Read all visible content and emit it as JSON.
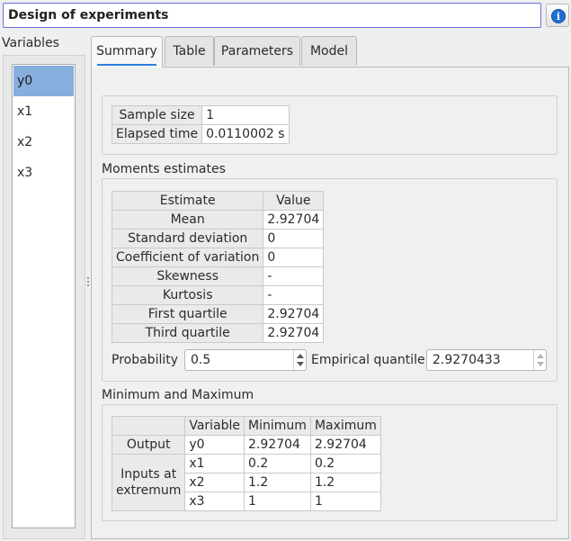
{
  "header": {
    "title": "Design of experiments",
    "info_icon": "info-icon",
    "info_glyph": "i"
  },
  "variables": {
    "label": "Variables",
    "items": [
      "y0",
      "x1",
      "x2",
      "x3"
    ],
    "selected": "y0"
  },
  "tabs": [
    "Summary",
    "Table",
    "Parameters",
    "Model"
  ],
  "active_tab": "Summary",
  "summary": {
    "sample_size_label": "Sample size",
    "sample_size": "1",
    "elapsed_time_label": "Elapsed time",
    "elapsed_time": "0.0110002 s"
  },
  "moments": {
    "title": "Moments estimates",
    "headers": [
      "Estimate",
      "Value"
    ],
    "rows": [
      [
        "Mean",
        "2.92704"
      ],
      [
        "Standard deviation",
        "0"
      ],
      [
        "Coefficient of variation",
        "0"
      ],
      [
        "Skewness",
        "-"
      ],
      [
        "Kurtosis",
        "-"
      ],
      [
        "First quartile",
        "2.92704"
      ],
      [
        "Third quartile",
        "2.92704"
      ]
    ],
    "probability_label": "Probability",
    "probability": "0.5",
    "quantile_label": "Empirical quantile",
    "quantile": "2.9270433"
  },
  "minmax": {
    "title": "Minimum and Maximum",
    "headers": [
      "",
      "Variable",
      "Minimum",
      "Maximum"
    ],
    "output_label": "Output",
    "inputs_label_1": "Inputs at",
    "inputs_label_2": "extremum",
    "rows": [
      [
        "y0",
        "2.92704",
        "2.92704"
      ],
      [
        "x1",
        "0.2",
        "0.2"
      ],
      [
        "x2",
        "1.2",
        "1.2"
      ],
      [
        "x3",
        "1",
        "1"
      ]
    ]
  },
  "colors": {
    "title_border": "#6b6fd8",
    "selection": "#87aedf",
    "tab_indicator": "#2f7fe0"
  }
}
